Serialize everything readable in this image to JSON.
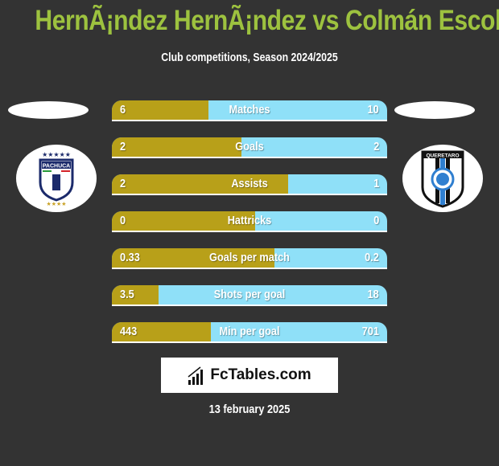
{
  "header": {
    "title": "HernÃ¡ndez HernÃ¡ndez vs Colmán Escobar",
    "subtitle": "Club competitions, Season 2024/2025"
  },
  "teams": {
    "left": {
      "name": "Pachuca",
      "logo_text": "PACHUCA"
    },
    "right": {
      "name": "Queretaro",
      "logo_text": "QUERETARO"
    }
  },
  "colors": {
    "left_bar": "#b8a019",
    "right_bar": "#8fe0f8",
    "title": "#9dc23f",
    "background": "#333333"
  },
  "stats": [
    {
      "label": "Matches",
      "left": "6",
      "right": "10",
      "left_share": 0.35
    },
    {
      "label": "Goals",
      "left": "2",
      "right": "2",
      "left_share": 0.47
    },
    {
      "label": "Assists",
      "left": "2",
      "right": "1",
      "left_share": 0.64
    },
    {
      "label": "Hattricks",
      "left": "0",
      "right": "0",
      "left_share": 0.52
    },
    {
      "label": "Goals per match",
      "left": "0.33",
      "right": "0.2",
      "left_share": 0.59
    },
    {
      "label": "Shots per goal",
      "left": "3.5",
      "right": "18",
      "left_share": 0.17
    },
    {
      "label": "Min per goal",
      "left": "443",
      "right": "701",
      "left_share": 0.36
    }
  ],
  "brand": {
    "name": "FcTables.com"
  },
  "date": "13 february 2025"
}
